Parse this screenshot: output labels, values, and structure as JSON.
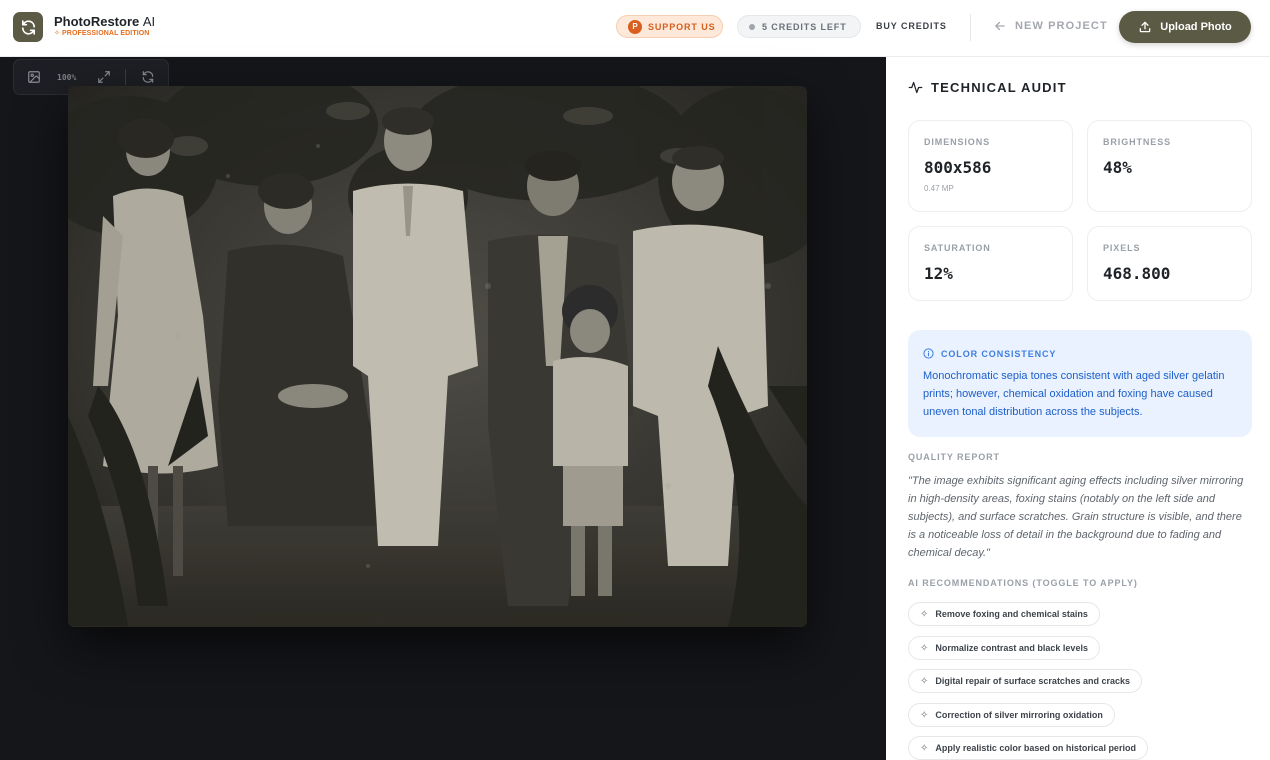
{
  "header": {
    "app_name": "PhotoRestore",
    "app_name_suffix": "AI",
    "edition": "PROFESSIONAL EDITION",
    "support_badge": "P",
    "support_label": "SUPPORT US",
    "credits_label": "5 CREDITS LEFT",
    "buy_credits_label": "BUY CREDITS",
    "new_project_label": "NEW PROJECT",
    "upload_label": "Upload Photo"
  },
  "canvas": {
    "zoom": "100%"
  },
  "audit": {
    "title": "TECHNICAL AUDIT",
    "stats": [
      {
        "label": "DIMENSIONS",
        "value": "800x586",
        "sub": "0.47 MP"
      },
      {
        "label": "BRIGHTNESS",
        "value": "48%"
      },
      {
        "label": "SATURATION",
        "value": "12%"
      },
      {
        "label": "PIXELS",
        "value": "468.800"
      }
    ],
    "consistency_title": "COLOR CONSISTENCY",
    "consistency_text": "Monochromatic sepia tones consistent with aged silver gelatin prints; however, chemical oxidation and foxing have caused uneven tonal distribution across the subjects.",
    "quality_title": "QUALITY REPORT",
    "quality_text": "\"The image exhibits significant aging effects including silver mirroring in high-density areas, foxing stains (notably on the left side and subjects), and surface scratches. Grain structure is visible, and there is a noticeable loss of detail in the background due to fading and chemical decay.\"",
    "recommendations_title": "AI RECOMMENDATIONS (TOGGLE TO APPLY)",
    "recommendations": [
      "Remove foxing and chemical stains",
      "Normalize contrast and black levels",
      "Digital repair of surface scratches and cracks",
      "Correction of silver mirroring oxidation",
      "Apply realistic color based on historical period"
    ]
  },
  "colors": {
    "brand": "#5b5a44",
    "accent": "#e56d1e",
    "info": "#3f7ee0",
    "canvas_bg": "#15161a"
  }
}
